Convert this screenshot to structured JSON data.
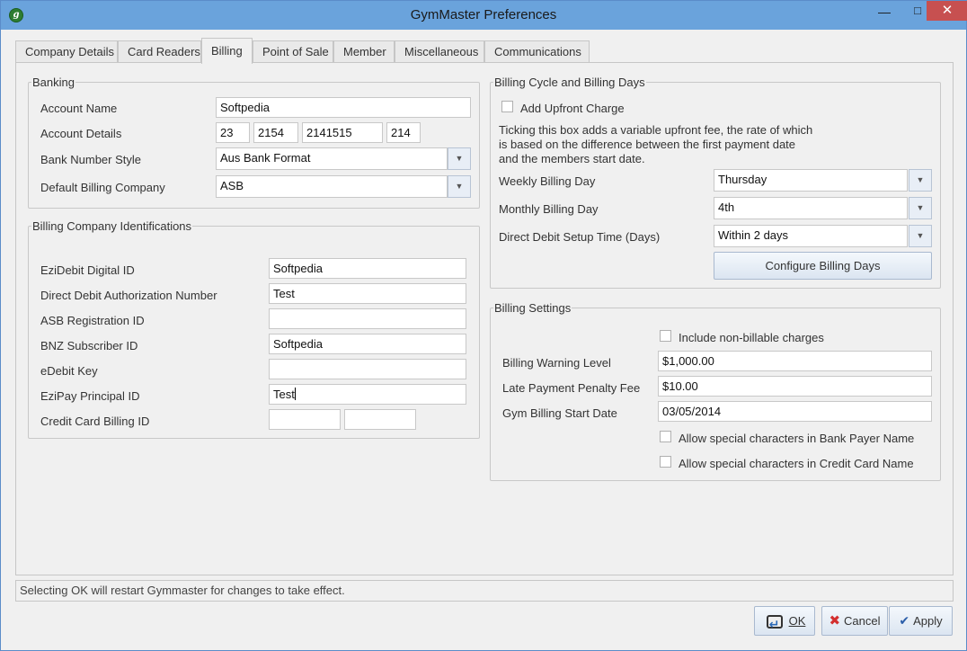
{
  "window": {
    "title": "GymMaster Preferences"
  },
  "tabs": [
    {
      "label": "Company Details"
    },
    {
      "label": "Card Readers"
    },
    {
      "label": "Billing"
    },
    {
      "label": "Point of Sale"
    },
    {
      "label": "Member"
    },
    {
      "label": "Miscellaneous"
    },
    {
      "label": "Communications"
    }
  ],
  "active_tab": "Billing",
  "banking": {
    "title": "Banking",
    "account_name_label": "Account Name",
    "account_name_value": "Softpedia",
    "account_details_label": "Account Details",
    "account_details_parts": [
      "23",
      "2154",
      "2141515",
      "214"
    ],
    "bank_number_style_label": "Bank Number Style",
    "bank_number_style_value": "Aus Bank Format",
    "default_billing_company_label": "Default Billing Company",
    "default_billing_company_value": "ASB"
  },
  "billing_ids": {
    "title": "Billing Company Identifications",
    "ezidebit_label": "EziDebit Digital ID",
    "ezidebit_value": "Softpedia",
    "dd_auth_label": "Direct Debit Authorization Number",
    "dd_auth_value": "Test",
    "asb_label": "ASB Registration ID",
    "asb_value": "",
    "bnz_label": "BNZ Subscriber ID",
    "bnz_value": "Softpedia",
    "edebit_label": "eDebit Key",
    "edebit_value": "",
    "ezipay_label": "EziPay Principal ID",
    "ezipay_value": "Test",
    "cc_label": "Credit Card Billing ID",
    "cc_value_1": "",
    "cc_value_2": ""
  },
  "billing_cycle": {
    "title": "Billing Cycle and Billing Days",
    "upfront_label": "Add Upfront Charge",
    "upfront_checked": false,
    "upfront_help": [
      "Ticking this box adds a variable upfront fee, the rate of which",
      "is based on the difference between the first payment date",
      "and the members start date."
    ],
    "weekly_label": "Weekly Billing Day",
    "weekly_value": "Thursday",
    "monthly_label": "Monthly Billing Day",
    "monthly_value": "4th",
    "dd_setup_label": "Direct Debit Setup Time (Days)",
    "dd_setup_value": "Within 2 days",
    "configure_button": "Configure Billing Days"
  },
  "billing_settings": {
    "title": "Billing Settings",
    "nonbillable_label": "Include non-billable charges",
    "nonbillable_checked": false,
    "warning_label": "Billing Warning Level",
    "warning_value": "$1,000.00",
    "penalty_label": "Late Payment Penalty Fee",
    "penalty_value": "$10.00",
    "start_date_label": "Gym Billing Start Date",
    "start_date_value": "03/05/2014",
    "special_bank_label": "Allow special characters in Bank Payer Name",
    "special_bank_checked": false,
    "special_cc_label": "Allow special characters in Credit Card Name",
    "special_cc_checked": false
  },
  "status": {
    "message": "Selecting OK will restart Gymmaster for changes to take effect."
  },
  "buttons": {
    "ok": "OK",
    "cancel": "Cancel",
    "apply": "Apply"
  },
  "icons": {
    "app": "gymmaster-app-icon",
    "minimize": "minimize-icon",
    "maximize": "maximize-icon",
    "close": "close-icon",
    "dropdown": "chevron-down-icon",
    "ok": "enter-key-icon",
    "cancel": "red-x-icon",
    "apply": "checkmark-icon"
  },
  "colors": {
    "titlebar": "#6aa3dc",
    "close_button": "#c75050",
    "cancel_icon": "#d32f2f"
  }
}
